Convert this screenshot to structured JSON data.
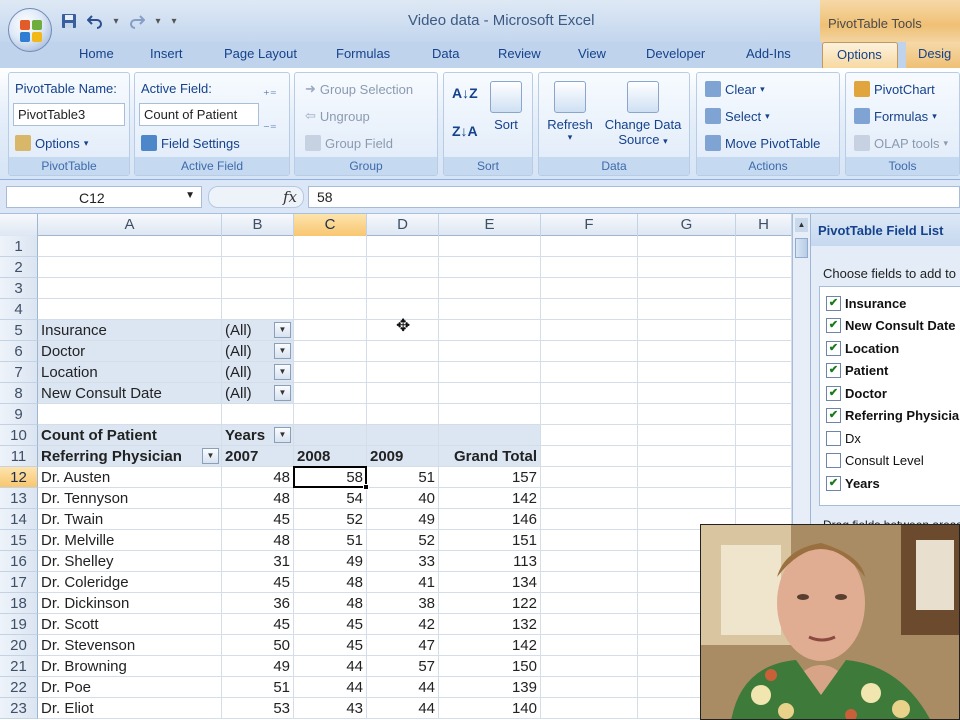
{
  "window": {
    "title": "Video data - Microsoft Excel",
    "context_title": "PivotTable Tools"
  },
  "qat": {
    "save_icon": "save-icon",
    "undo_icon": "undo-icon",
    "redo_icon": "redo-icon"
  },
  "tabs": [
    "Home",
    "Insert",
    "Page Layout",
    "Formulas",
    "Data",
    "Review",
    "View",
    "Developer",
    "Add-Ins"
  ],
  "context_tabs": {
    "options": "Options",
    "design": "Desig"
  },
  "ribbon": {
    "pivottable": {
      "name_label": "PivotTable Name:",
      "name_value": "PivotTable3",
      "options_label": "Options",
      "group_label": "PivotTable"
    },
    "active_field": {
      "label": "Active Field:",
      "value": "Count of Patient",
      "settings_label": "Field Settings",
      "group_label": "Active Field"
    },
    "group": {
      "selection": "Group Selection",
      "ungroup": "Ungroup",
      "field": "Group Field",
      "group_label": "Group"
    },
    "sort": {
      "sort_label": "Sort",
      "group_label": "Sort"
    },
    "data": {
      "refresh_label": "Refresh",
      "change_source_line1": "Change Data",
      "change_source_line2": "Source",
      "group_label": "Data"
    },
    "actions": {
      "clear": "Clear",
      "select": "Select",
      "move": "Move PivotTable",
      "group_label": "Actions"
    },
    "tools": {
      "pivotchart": "PivotChart",
      "formulas": "Formulas",
      "olap": "OLAP tools",
      "group_label": "Tools"
    }
  },
  "formula_bar": {
    "name_box": "C12",
    "fx": "fx",
    "value": "58"
  },
  "columns": [
    "A",
    "B",
    "C",
    "D",
    "E",
    "F",
    "G",
    "H"
  ],
  "selected_column": "C",
  "selected_row": 12,
  "report_filters": [
    {
      "field": "Insurance",
      "value": "(All)"
    },
    {
      "field": "Doctor",
      "value": "(All)"
    },
    {
      "field": "Location",
      "value": "(All)"
    },
    {
      "field": "New Consult Date",
      "value": "(All)"
    }
  ],
  "pivot": {
    "values_label": "Count of Patient",
    "column_field": "Years",
    "row_field": "Referring Physician",
    "column_headers": [
      "2007",
      "2008",
      "2009",
      "Grand Total"
    ],
    "rows": [
      {
        "name": "Dr. Austen",
        "v2007": "48",
        "v2008": "58",
        "v2009": "51",
        "total": "157"
      },
      {
        "name": "Dr. Tennyson",
        "v2007": "48",
        "v2008": "54",
        "v2009": "40",
        "total": "142"
      },
      {
        "name": "Dr. Twain",
        "v2007": "45",
        "v2008": "52",
        "v2009": "49",
        "total": "146"
      },
      {
        "name": "Dr. Melville",
        "v2007": "48",
        "v2008": "51",
        "v2009": "52",
        "total": "151"
      },
      {
        "name": "Dr. Shelley",
        "v2007": "31",
        "v2008": "49",
        "v2009": "33",
        "total": "113"
      },
      {
        "name": "Dr. Coleridge",
        "v2007": "45",
        "v2008": "48",
        "v2009": "41",
        "total": "134"
      },
      {
        "name": "Dr. Dickinson",
        "v2007": "36",
        "v2008": "48",
        "v2009": "38",
        "total": "122"
      },
      {
        "name": "Dr. Scott",
        "v2007": "45",
        "v2008": "45",
        "v2009": "42",
        "total": "132"
      },
      {
        "name": "Dr. Stevenson",
        "v2007": "50",
        "v2008": "45",
        "v2009": "47",
        "total": "142"
      },
      {
        "name": "Dr. Browning",
        "v2007": "49",
        "v2008": "44",
        "v2009": "57",
        "total": "150"
      },
      {
        "name": "Dr. Poe",
        "v2007": "51",
        "v2008": "44",
        "v2009": "44",
        "total": "139"
      },
      {
        "name": "Dr. Eliot",
        "v2007": "53",
        "v2008": "43",
        "v2009": "44",
        "total": "140"
      }
    ]
  },
  "field_list": {
    "title": "PivotTable Field List",
    "choose_label": "Choose fields to add to",
    "fields": [
      {
        "name": "Insurance",
        "checked": true
      },
      {
        "name": "New Consult Date",
        "checked": true
      },
      {
        "name": "Location",
        "checked": true
      },
      {
        "name": "Patient",
        "checked": true
      },
      {
        "name": "Doctor",
        "checked": true
      },
      {
        "name": "Referring Physician",
        "checked": true
      },
      {
        "name": "Dx",
        "checked": false
      },
      {
        "name": "Consult Level",
        "checked": false
      },
      {
        "name": "Years",
        "checked": true
      }
    ],
    "drop_label": "Drag fields between areas"
  },
  "colors": {
    "accent": "#15428b",
    "context_tab": "#f2c77e",
    "pivot_header": "#dce6f2",
    "selection": "#f8c670"
  }
}
